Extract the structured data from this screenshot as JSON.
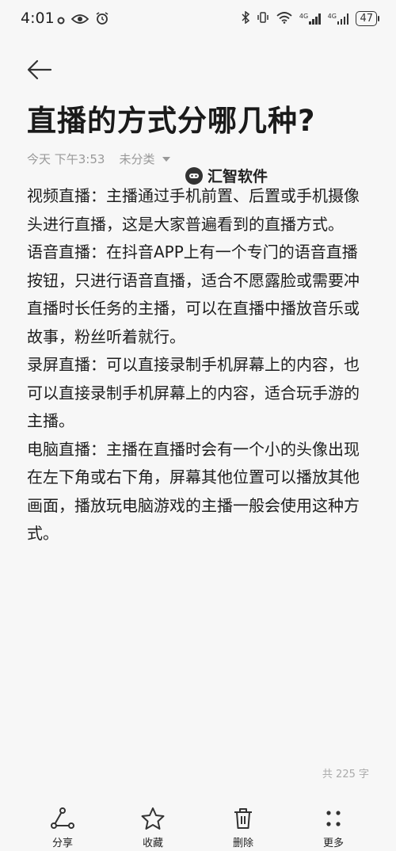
{
  "status_bar": {
    "time": "4:01",
    "battery": "47",
    "signal_1_label": "4G",
    "signal_2_label": "4G",
    "icons": [
      "notification-dot-icon",
      "eye-icon",
      "alarm-icon",
      "bluetooth-icon",
      "vibrate-icon",
      "wifi-icon",
      "signal-icon",
      "signal-icon",
      "battery-icon"
    ]
  },
  "note": {
    "title": "直播的方式分哪几种?",
    "date": "今天 下午3:53",
    "category": "未分类",
    "watermark": "汇智软件",
    "paragraphs": [
      "视频直播：主播通过手机前置、后置或手机摄像头进行直播，这是大家普遍看到的直播方式。",
      "语音直播：在抖音APP上有一个专门的语音直播按钮，只进行语音直播，适合不愿露脸或需要冲直播时长任务的主播，可以在直播中播放音乐或故事，粉丝听着就行。",
      "录屏直播：可以直接录制手机屏幕上的内容，也可以直接录制手机屏幕上的内容，适合玩手游的主播。",
      "电脑直播：主播在直播时会有一个小的头像出现在左下角或右下角，屏幕其他位置可以播放其他画面，播放玩电脑游戏的主播一般会使用这种方式。"
    ],
    "word_count": "共 225 字"
  },
  "toolbar": {
    "share": "分享",
    "favorite": "收藏",
    "delete": "删除",
    "more": "更多"
  }
}
